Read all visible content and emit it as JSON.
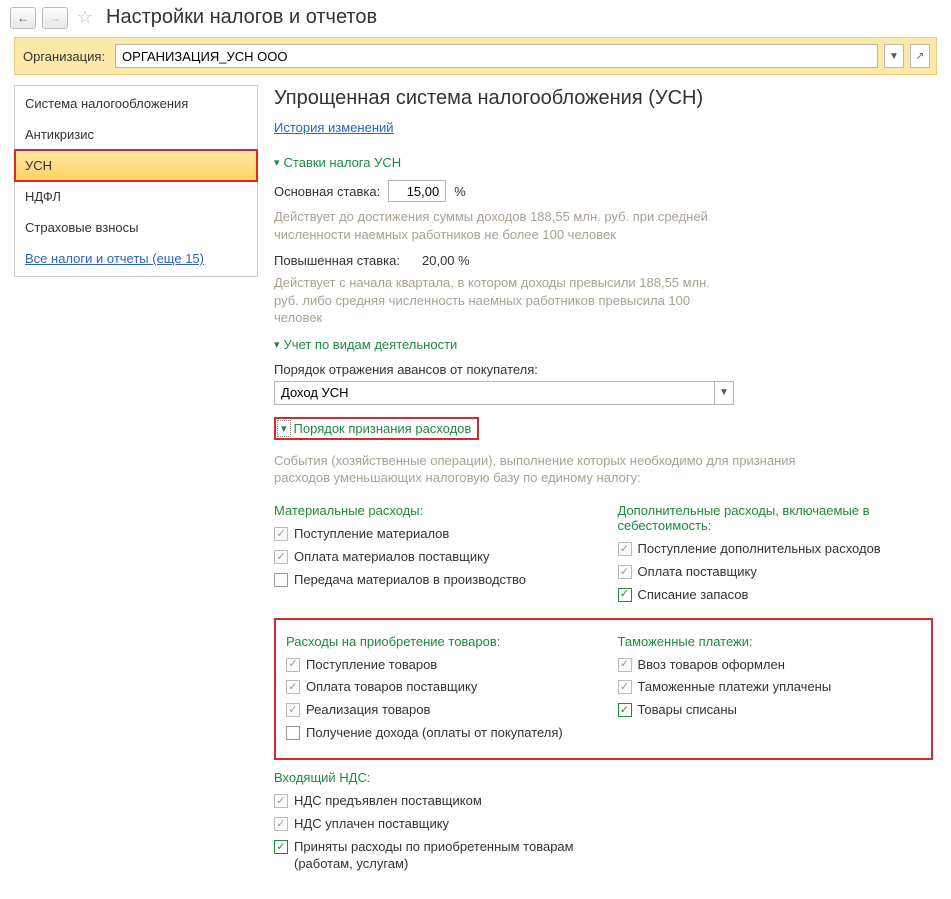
{
  "header": {
    "title": "Настройки налогов и отчетов"
  },
  "org": {
    "label": "Организация:",
    "value": "ОРГАНИЗАЦИЯ_УСН ООО"
  },
  "sidebar": {
    "items": [
      {
        "label": "Система налогообложения"
      },
      {
        "label": "Антикризис"
      },
      {
        "label": "УСН"
      },
      {
        "label": "НДФЛ"
      },
      {
        "label": "Страховые взносы"
      }
    ],
    "more_link": "Все налоги и отчеты (еще 15)"
  },
  "main": {
    "heading": "Упрощенная система налогообложения (УСН)",
    "history_link": "История изменений",
    "rates_section": "Ставки налога УСН",
    "base_rate_label": "Основная ставка:",
    "base_rate_value": "15,00",
    "percent": "%",
    "base_rate_note": "Действует до достижения суммы доходов 188,55 млн. руб. при средней численности наемных работников не более 100 человек",
    "high_rate_label": "Повышенная ставка:",
    "high_rate_value": "20,00 %",
    "high_rate_note": "Действует с начала квартала, в котором доходы превысили 188,55 млн. руб. либо средняя численность наемных работников превысила 100 человек",
    "activity_section": "Учет по видам деятельности",
    "advance_label": "Порядок отражения авансов от покупателя:",
    "advance_value": "Доход УСН",
    "expense_section": "Порядок признания расходов",
    "expense_note": "События (хозяйственные операции), выполнение которых необходимо для признания расходов уменьшающих налоговую базу по единому налогу:",
    "material": {
      "head": "Материальные расходы:",
      "items": [
        {
          "type": "locked",
          "label": "Поступление материалов"
        },
        {
          "type": "locked",
          "label": "Оплата материалов поставщику"
        },
        {
          "type": "empty",
          "label": "Передача материалов в производство"
        }
      ]
    },
    "additional": {
      "head": "Дополнительные расходы, включаемые в себестоимость:",
      "items": [
        {
          "type": "locked",
          "label": "Поступление дополнительных расходов"
        },
        {
          "type": "locked",
          "label": "Оплата поставщику"
        },
        {
          "type": "green",
          "label": "Списание запасов"
        }
      ]
    },
    "goods": {
      "head": "Расходы на приобретение товаров:",
      "items": [
        {
          "type": "locked",
          "label": "Поступление товаров"
        },
        {
          "type": "locked",
          "label": "Оплата товаров поставщику"
        },
        {
          "type": "locked",
          "label": "Реализация товаров"
        },
        {
          "type": "empty",
          "label": "Получение дохода (оплаты от покупателя)"
        }
      ]
    },
    "customs": {
      "head": "Таможенные платежи:",
      "items": [
        {
          "type": "locked",
          "label": "Ввоз товаров оформлен"
        },
        {
          "type": "locked",
          "label": "Таможенные платежи уплачены"
        },
        {
          "type": "green",
          "label": "Товары списаны"
        }
      ]
    },
    "vat": {
      "head": "Входящий НДС:",
      "items": [
        {
          "type": "locked",
          "label": "НДС предъявлен поставщиком"
        },
        {
          "type": "locked",
          "label": "НДС уплачен поставщику"
        },
        {
          "type": "green",
          "label": "Приняты расходы по приобретенным товарам (работам, услугам)"
        }
      ]
    }
  }
}
